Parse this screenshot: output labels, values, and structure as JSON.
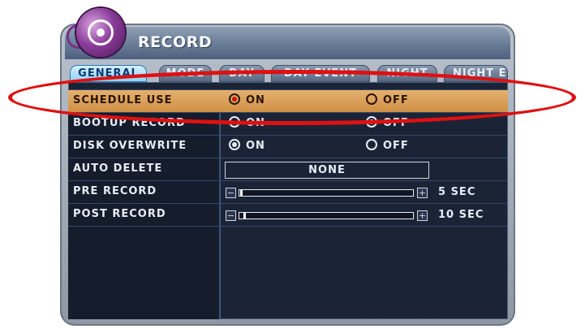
{
  "window": {
    "title": "RECORD"
  },
  "tabs": [
    {
      "label": "GENERAL",
      "active": true
    },
    {
      "label": "MODE",
      "active": false
    },
    {
      "label": "DAY",
      "active": false
    },
    {
      "label": "DAY EVENT",
      "active": false
    },
    {
      "label": "NIGHT",
      "active": false
    },
    {
      "label": "NIGHT E",
      "active": false
    }
  ],
  "settings": {
    "schedule_use": {
      "label": "SCHEDULE USE",
      "on_label": "ON",
      "off_label": "OFF",
      "selected": "ON"
    },
    "bootup_record": {
      "label": "BOOTUP RECORD",
      "on_label": "ON",
      "off_label": "OFF",
      "selected": "OFF"
    },
    "disk_overwrite": {
      "label": "DISK OVERWRITE",
      "on_label": "ON",
      "off_label": "OFF",
      "selected": "ON"
    },
    "auto_delete": {
      "label": "AUTO DELETE",
      "value": "NONE"
    },
    "pre_record": {
      "label": "PRE RECORD",
      "value": "5 SEC",
      "level": 0.02
    },
    "post_record": {
      "label": "POST RECORD",
      "value": "10 SEC",
      "level": 0.04
    }
  },
  "colors": {
    "highlight": "#d99a52",
    "annotation": "#e01010",
    "panel": "#1b2436",
    "active_tab": "#8fd0f3"
  }
}
